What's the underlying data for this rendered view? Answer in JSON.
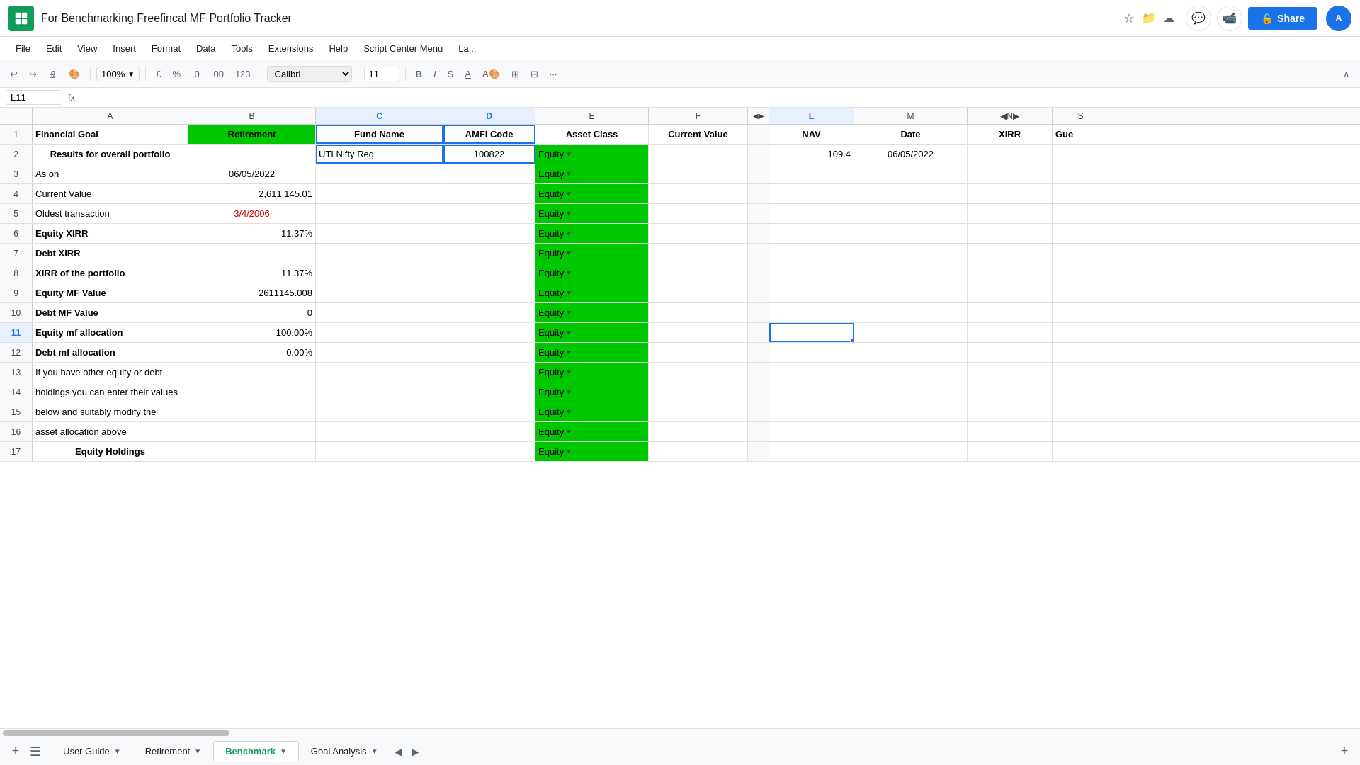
{
  "titleBar": {
    "title": "For Benchmarking Freefincal MF Portfolio Tracker",
    "shareLabel": "Share",
    "avatarText": "A"
  },
  "menuBar": {
    "items": [
      "File",
      "Edit",
      "View",
      "Insert",
      "Format",
      "Data",
      "Tools",
      "Extensions",
      "Help",
      "Script Center Menu",
      "La..."
    ]
  },
  "toolbar": {
    "zoom": "100%",
    "currency": "£",
    "percent": "%",
    "decDecrease": ".0",
    "decIncrease": ".00",
    "format123": "123",
    "fontFamily": "Calibri",
    "fontSize": "11",
    "moreBtn": "···"
  },
  "formulaBar": {
    "cellRef": "L11",
    "fxLabel": "fx"
  },
  "columns": {
    "headers": [
      "A",
      "B",
      "C",
      "D",
      "E",
      "F",
      "",
      "L",
      "M",
      "N",
      "S"
    ],
    "widths": [
      220,
      180,
      180,
      130,
      160,
      140,
      30,
      120,
      160,
      120,
      80
    ]
  },
  "rows": [
    {
      "num": 1,
      "cells": [
        {
          "col": "a",
          "text": "Financial Goal",
          "bold": true
        },
        {
          "col": "b",
          "text": "Retirement",
          "bold": true,
          "greenBg": true,
          "align": "center"
        },
        {
          "col": "c",
          "text": "Fund Name",
          "bold": true,
          "outlined": true,
          "align": "center"
        },
        {
          "col": "d",
          "text": "AMFI Code",
          "bold": true,
          "outlined": true,
          "align": "center"
        },
        {
          "col": "e",
          "text": "Asset Class",
          "bold": true,
          "align": "center"
        },
        {
          "col": "f",
          "text": "Current Value",
          "bold": true,
          "align": "center"
        },
        {
          "col": "g",
          "text": ""
        },
        {
          "col": "l",
          "text": "NAV",
          "bold": true,
          "align": "center"
        },
        {
          "col": "m",
          "text": "Date",
          "bold": true,
          "align": "center"
        },
        {
          "col": "n",
          "text": "XIRR",
          "bold": true,
          "align": "center"
        },
        {
          "col": "s",
          "text": "Gue",
          "bold": true
        }
      ]
    },
    {
      "num": 2,
      "cells": [
        {
          "col": "a",
          "text": "Results for overall portfolio",
          "bold": true,
          "align": "center"
        },
        {
          "col": "b",
          "text": ""
        },
        {
          "col": "c",
          "text": "UTI Nifty Reg",
          "outlined": true
        },
        {
          "col": "d",
          "text": "100822",
          "outlined": true,
          "align": "center"
        },
        {
          "col": "e",
          "text": "Equity",
          "greenBg": true,
          "dropdown": true
        },
        {
          "col": "f",
          "text": ""
        },
        {
          "col": "g",
          "text": ""
        },
        {
          "col": "l",
          "text": "109.4",
          "align": "right"
        },
        {
          "col": "m",
          "text": "06/05/2022",
          "align": "center"
        },
        {
          "col": "n",
          "text": ""
        },
        {
          "col": "s",
          "text": ""
        }
      ]
    },
    {
      "num": 3,
      "cells": [
        {
          "col": "a",
          "text": "As on"
        },
        {
          "col": "b",
          "text": "06/05/2022",
          "align": "center"
        },
        {
          "col": "c",
          "text": ""
        },
        {
          "col": "d",
          "text": ""
        },
        {
          "col": "e",
          "text": "Equity",
          "greenBg": true,
          "dropdown": true
        },
        {
          "col": "f",
          "text": ""
        },
        {
          "col": "g",
          "text": ""
        },
        {
          "col": "l",
          "text": ""
        },
        {
          "col": "m",
          "text": ""
        },
        {
          "col": "n",
          "text": ""
        },
        {
          "col": "s",
          "text": ""
        }
      ]
    },
    {
      "num": 4,
      "cells": [
        {
          "col": "a",
          "text": "Current Value"
        },
        {
          "col": "b",
          "text": "2,611,145.01",
          "align": "right"
        },
        {
          "col": "c",
          "text": ""
        },
        {
          "col": "d",
          "text": ""
        },
        {
          "col": "e",
          "text": "Equity",
          "greenBg": true,
          "dropdown": true
        },
        {
          "col": "f",
          "text": ""
        },
        {
          "col": "g",
          "text": ""
        },
        {
          "col": "l",
          "text": ""
        },
        {
          "col": "m",
          "text": ""
        },
        {
          "col": "n",
          "text": ""
        },
        {
          "col": "s",
          "text": ""
        }
      ]
    },
    {
      "num": 5,
      "cells": [
        {
          "col": "a",
          "text": "Oldest transaction"
        },
        {
          "col": "b",
          "text": "3/4/2006",
          "align": "center",
          "color": "red"
        },
        {
          "col": "c",
          "text": ""
        },
        {
          "col": "d",
          "text": ""
        },
        {
          "col": "e",
          "text": "Equity",
          "greenBg": true,
          "dropdown": true
        },
        {
          "col": "f",
          "text": ""
        },
        {
          "col": "g",
          "text": ""
        },
        {
          "col": "l",
          "text": ""
        },
        {
          "col": "m",
          "text": ""
        },
        {
          "col": "n",
          "text": ""
        },
        {
          "col": "s",
          "text": ""
        }
      ]
    },
    {
      "num": 6,
      "cells": [
        {
          "col": "a",
          "text": "Equity XIRR",
          "bold": true
        },
        {
          "col": "b",
          "text": "11.37%",
          "align": "right"
        },
        {
          "col": "c",
          "text": ""
        },
        {
          "col": "d",
          "text": ""
        },
        {
          "col": "e",
          "text": "Equity",
          "greenBg": true,
          "dropdown": true
        },
        {
          "col": "f",
          "text": ""
        },
        {
          "col": "g",
          "text": ""
        },
        {
          "col": "l",
          "text": ""
        },
        {
          "col": "m",
          "text": ""
        },
        {
          "col": "n",
          "text": ""
        },
        {
          "col": "s",
          "text": ""
        }
      ]
    },
    {
      "num": 7,
      "cells": [
        {
          "col": "a",
          "text": "Debt XIRR",
          "bold": true
        },
        {
          "col": "b",
          "text": ""
        },
        {
          "col": "c",
          "text": ""
        },
        {
          "col": "d",
          "text": ""
        },
        {
          "col": "e",
          "text": "Equity",
          "greenBg": true,
          "dropdown": true
        },
        {
          "col": "f",
          "text": ""
        },
        {
          "col": "g",
          "text": ""
        },
        {
          "col": "l",
          "text": ""
        },
        {
          "col": "m",
          "text": ""
        },
        {
          "col": "n",
          "text": ""
        },
        {
          "col": "s",
          "text": ""
        }
      ]
    },
    {
      "num": 8,
      "cells": [
        {
          "col": "a",
          "text": "XIRR of the portfolio",
          "bold": true
        },
        {
          "col": "b",
          "text": "11.37%",
          "align": "right"
        },
        {
          "col": "c",
          "text": ""
        },
        {
          "col": "d",
          "text": ""
        },
        {
          "col": "e",
          "text": "Equity",
          "greenBg": true,
          "dropdown": true
        },
        {
          "col": "f",
          "text": ""
        },
        {
          "col": "g",
          "text": ""
        },
        {
          "col": "l",
          "text": ""
        },
        {
          "col": "m",
          "text": ""
        },
        {
          "col": "n",
          "text": ""
        },
        {
          "col": "s",
          "text": ""
        }
      ]
    },
    {
      "num": 9,
      "cells": [
        {
          "col": "a",
          "text": "Equity MF Value",
          "bold": true
        },
        {
          "col": "b",
          "text": "2611145.008",
          "align": "right"
        },
        {
          "col": "c",
          "text": ""
        },
        {
          "col": "d",
          "text": ""
        },
        {
          "col": "e",
          "text": "Equity",
          "greenBg": true,
          "dropdown": true
        },
        {
          "col": "f",
          "text": ""
        },
        {
          "col": "g",
          "text": ""
        },
        {
          "col": "l",
          "text": ""
        },
        {
          "col": "m",
          "text": ""
        },
        {
          "col": "n",
          "text": ""
        },
        {
          "col": "s",
          "text": ""
        }
      ]
    },
    {
      "num": 10,
      "cells": [
        {
          "col": "a",
          "text": "Debt MF Value",
          "bold": true
        },
        {
          "col": "b",
          "text": "0",
          "align": "right"
        },
        {
          "col": "c",
          "text": ""
        },
        {
          "col": "d",
          "text": ""
        },
        {
          "col": "e",
          "text": "Equity",
          "greenBg": true,
          "dropdown": true
        },
        {
          "col": "f",
          "text": ""
        },
        {
          "col": "g",
          "text": ""
        },
        {
          "col": "l",
          "text": ""
        },
        {
          "col": "m",
          "text": ""
        },
        {
          "col": "n",
          "text": ""
        },
        {
          "col": "s",
          "text": ""
        }
      ]
    },
    {
      "num": 11,
      "cells": [
        {
          "col": "a",
          "text": "Equity mf allocation",
          "bold": true
        },
        {
          "col": "b",
          "text": "100.00%",
          "align": "right"
        },
        {
          "col": "c",
          "text": ""
        },
        {
          "col": "d",
          "text": ""
        },
        {
          "col": "e",
          "text": "Equity",
          "greenBg": true,
          "dropdown": true
        },
        {
          "col": "f",
          "text": ""
        },
        {
          "col": "g",
          "text": ""
        },
        {
          "col": "l",
          "text": "",
          "selected": true
        },
        {
          "col": "m",
          "text": ""
        },
        {
          "col": "n",
          "text": ""
        },
        {
          "col": "s",
          "text": ""
        }
      ]
    },
    {
      "num": 12,
      "cells": [
        {
          "col": "a",
          "text": "Debt mf allocation",
          "bold": true
        },
        {
          "col": "b",
          "text": "0.00%",
          "align": "right"
        },
        {
          "col": "c",
          "text": ""
        },
        {
          "col": "d",
          "text": ""
        },
        {
          "col": "e",
          "text": "Equity",
          "greenBg": true,
          "dropdown": true
        },
        {
          "col": "f",
          "text": ""
        },
        {
          "col": "g",
          "text": ""
        },
        {
          "col": "l",
          "text": ""
        },
        {
          "col": "m",
          "text": ""
        },
        {
          "col": "n",
          "text": ""
        },
        {
          "col": "s",
          "text": ""
        }
      ]
    },
    {
      "num": 13,
      "cells": [
        {
          "col": "a",
          "text": "If you have other equity or debt"
        },
        {
          "col": "b",
          "text": ""
        },
        {
          "col": "c",
          "text": ""
        },
        {
          "col": "d",
          "text": ""
        },
        {
          "col": "e",
          "text": "Equity",
          "greenBg": true,
          "dropdown": true
        },
        {
          "col": "f",
          "text": ""
        },
        {
          "col": "g",
          "text": ""
        },
        {
          "col": "l",
          "text": ""
        },
        {
          "col": "m",
          "text": ""
        },
        {
          "col": "n",
          "text": ""
        },
        {
          "col": "s",
          "text": ""
        }
      ]
    },
    {
      "num": 14,
      "cells": [
        {
          "col": "a",
          "text": "holdings you can enter their values"
        },
        {
          "col": "b",
          "text": ""
        },
        {
          "col": "c",
          "text": ""
        },
        {
          "col": "d",
          "text": ""
        },
        {
          "col": "e",
          "text": "Equity",
          "greenBg": true,
          "dropdown": true
        },
        {
          "col": "f",
          "text": ""
        },
        {
          "col": "g",
          "text": ""
        },
        {
          "col": "l",
          "text": ""
        },
        {
          "col": "m",
          "text": ""
        },
        {
          "col": "n",
          "text": ""
        },
        {
          "col": "s",
          "text": ""
        }
      ]
    },
    {
      "num": 15,
      "cells": [
        {
          "col": "a",
          "text": "below and suitably modify the"
        },
        {
          "col": "b",
          "text": ""
        },
        {
          "col": "c",
          "text": ""
        },
        {
          "col": "d",
          "text": ""
        },
        {
          "col": "e",
          "text": "Equity",
          "greenBg": true,
          "dropdown": true
        },
        {
          "col": "f",
          "text": ""
        },
        {
          "col": "g",
          "text": ""
        },
        {
          "col": "l",
          "text": ""
        },
        {
          "col": "m",
          "text": ""
        },
        {
          "col": "n",
          "text": ""
        },
        {
          "col": "s",
          "text": ""
        }
      ]
    },
    {
      "num": 16,
      "cells": [
        {
          "col": "a",
          "text": "asset allocation above"
        },
        {
          "col": "b",
          "text": ""
        },
        {
          "col": "c",
          "text": ""
        },
        {
          "col": "d",
          "text": ""
        },
        {
          "col": "e",
          "text": "Equity",
          "greenBg": true,
          "dropdown": true
        },
        {
          "col": "f",
          "text": ""
        },
        {
          "col": "g",
          "text": ""
        },
        {
          "col": "l",
          "text": ""
        },
        {
          "col": "m",
          "text": ""
        },
        {
          "col": "n",
          "text": ""
        },
        {
          "col": "s",
          "text": ""
        }
      ]
    },
    {
      "num": 17,
      "cells": [
        {
          "col": "a",
          "text": "Equity Holdings",
          "bold": true,
          "align": "center"
        },
        {
          "col": "b",
          "text": ""
        },
        {
          "col": "c",
          "text": ""
        },
        {
          "col": "d",
          "text": ""
        },
        {
          "col": "e",
          "text": "Equity",
          "greenBg": true,
          "dropdown": true
        },
        {
          "col": "f",
          "text": ""
        },
        {
          "col": "g",
          "text": ""
        },
        {
          "col": "l",
          "text": ""
        },
        {
          "col": "m",
          "text": ""
        },
        {
          "col": "n",
          "text": ""
        },
        {
          "col": "s",
          "text": ""
        }
      ]
    }
  ],
  "tabs": {
    "items": [
      {
        "label": "User Guide",
        "active": false,
        "hasArrow": true
      },
      {
        "label": "Retirement",
        "active": false,
        "hasArrow": true
      },
      {
        "label": "Benchmark",
        "active": true,
        "hasArrow": true
      },
      {
        "label": "Goal Analysis",
        "active": false,
        "hasArrow": true
      }
    ]
  }
}
